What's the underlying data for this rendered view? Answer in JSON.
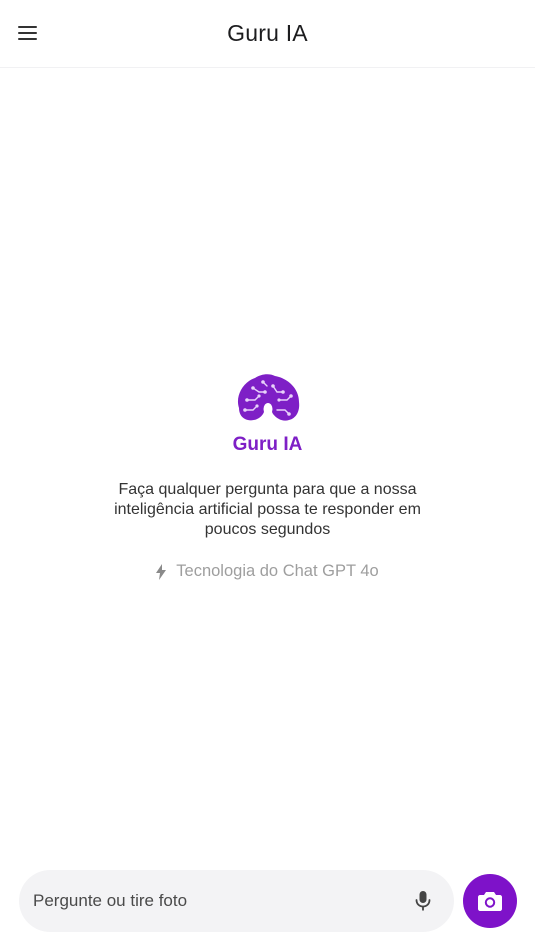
{
  "header": {
    "title": "Guru IA",
    "menu_icon": "hamburger-menu-icon"
  },
  "welcome": {
    "logo_icon": "brain-circuit-icon",
    "brand": "Guru IA",
    "description": "Faça qualquer pergunta para que a nossa inteligência artificial possa te responder em poucos segundos",
    "tech_icon": "lightning-bolt-icon",
    "tech_label": "Tecnologia do Chat GPT 4o"
  },
  "composer": {
    "placeholder": "Pergunte ou tire foto",
    "value": "",
    "mic_icon": "microphone-icon",
    "camera_icon": "camera-icon"
  },
  "colors": {
    "accent": "#7e12c9",
    "brand_text": "#7e1fc6",
    "muted_text": "#9e9e9e",
    "input_bg": "#f3f3f5"
  }
}
